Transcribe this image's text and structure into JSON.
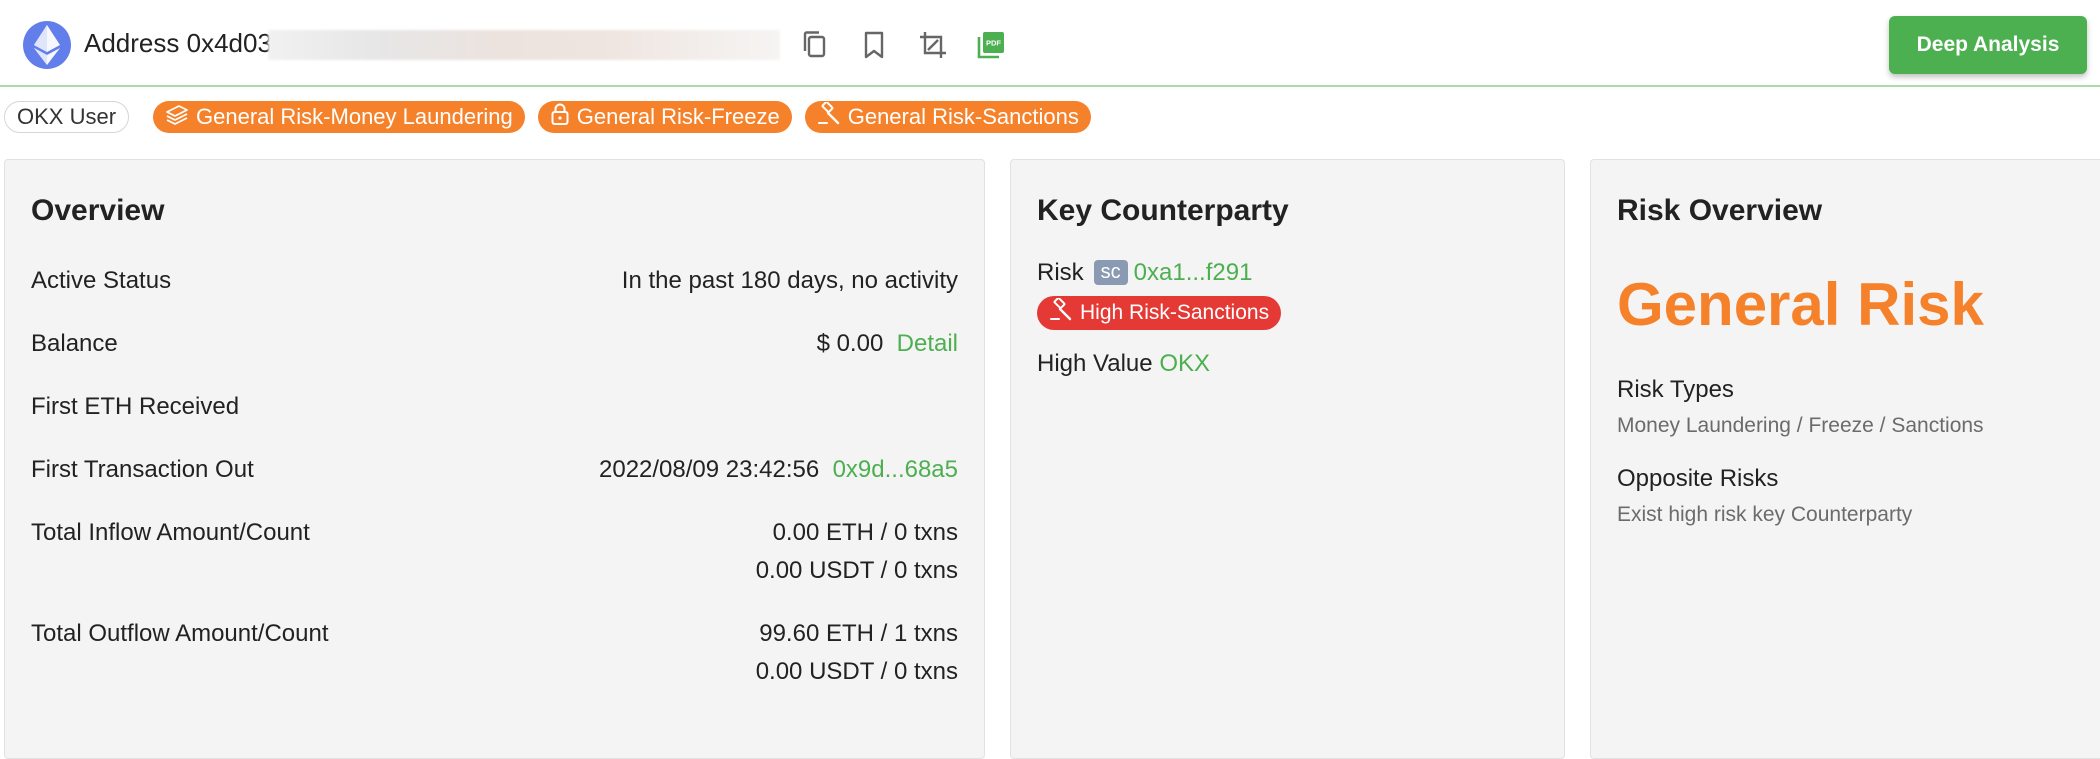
{
  "header": {
    "address_label": "Address 0x4d03",
    "deep_analysis_label": "Deep Analysis"
  },
  "tags": {
    "user": "OKX User",
    "money_laundering": "General Risk-Money Laundering",
    "freeze": "General Risk-Freeze",
    "sanctions": "General Risk-Sanctions"
  },
  "overview": {
    "title": "Overview",
    "active_status_label": "Active Status",
    "active_status_value": "In the past 180 days, no activity",
    "balance_label": "Balance",
    "balance_value": "$ 0.00",
    "balance_detail": "Detail",
    "first_eth_received_label": "First ETH Received",
    "first_tx_out_label": "First Transaction Out",
    "first_tx_out_time": "2022/08/09 23:42:56",
    "first_tx_out_hash": "0x9d...68a5",
    "inflow_label": "Total Inflow Amount/Count",
    "inflow_eth": "0.00 ETH / 0 txns",
    "inflow_usdt": "0.00 USDT / 0 txns",
    "outflow_label": "Total Outflow Amount/Count",
    "outflow_eth": "99.60 ETH / 1 txns",
    "outflow_usdt": "0.00 USDT / 0 txns"
  },
  "counterparty": {
    "title": "Key Counterparty",
    "risk_label": "Risk",
    "sc_chip": "sc",
    "risk_address": "0xa1...f291",
    "risk_tag": "High Risk-Sanctions",
    "high_value_label": "High Value",
    "high_value_name": "OKX"
  },
  "risk_overview": {
    "title": "Risk Overview",
    "level": "General Risk",
    "risk_types_label": "Risk Types",
    "risk_types_value": "Money Laundering / Freeze / Sanctions",
    "opposite_risks_label": "Opposite Risks",
    "opposite_risks_value": "Exist high risk key Counterparty"
  },
  "colors": {
    "accent_green": "#4caf50",
    "risk_orange": "#f5822a",
    "risk_red": "#e53935",
    "eth_blue": "#627eea"
  },
  "icons": [
    "eth-logo-icon",
    "copy-icon",
    "bookmark-icon",
    "crop-icon",
    "pdf-icon",
    "money-icon",
    "lock-icon",
    "gavel-icon"
  ]
}
